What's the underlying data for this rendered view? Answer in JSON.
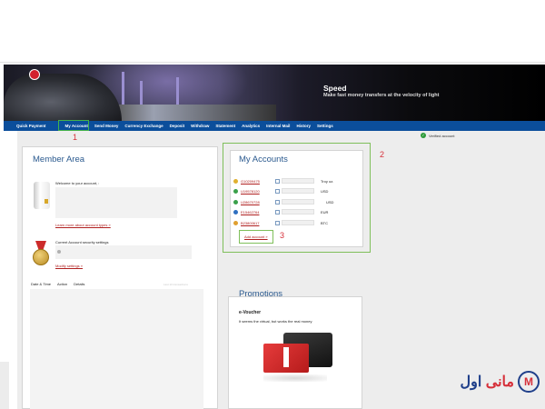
{
  "banner": {
    "title": "Speed",
    "subtitle": "Make fast money transfers at the velocity of light"
  },
  "nav": {
    "items": [
      "Quick Payment",
      "My Account",
      "Send Money",
      "Currency Exchange",
      "Deposit",
      "Withdraw",
      "Statement",
      "Analytics",
      "Internal Mail",
      "History",
      "Settings"
    ]
  },
  "status": {
    "verified": "Verified account"
  },
  "member": {
    "title": "Member Area",
    "welcome": "Welcome to your account, :",
    "learn_link": "Learn more about account types »",
    "security_title": "Current Account security settings",
    "modify_link": "Modify settings »",
    "history_headers": [
      "Date & Time",
      "Action",
      "Details"
    ],
    "history_faint": "Last 10 transactions"
  },
  "accounts": {
    "title": "My Accounts",
    "rows": [
      {
        "number": "G10209475",
        "currency": "Troy oz.",
        "icon_color": "#e0b030"
      },
      {
        "number": "U19578120",
        "currency": "USD",
        "icon_color": "#3aa04a"
      },
      {
        "number": "U28670728",
        "currency": "USD",
        "icon_color": "#3aa04a"
      },
      {
        "number": "E15462764",
        "currency": "EUR",
        "icon_color": "#2f6fc0"
      },
      {
        "number": "B23800617",
        "currency": "BTC",
        "icon_color": "#e0a030"
      }
    ],
    "add_link": "Add account »"
  },
  "markers": {
    "one": "1",
    "two": "2",
    "three": "3"
  },
  "promotions": {
    "title": "Promotions",
    "item_title": "e-Voucher",
    "item_desc": "It seems the virtual, but works the real money"
  },
  "watermark": {
    "text_red": "مانی",
    "text_blue": "اول",
    "logo_letter": "M"
  }
}
